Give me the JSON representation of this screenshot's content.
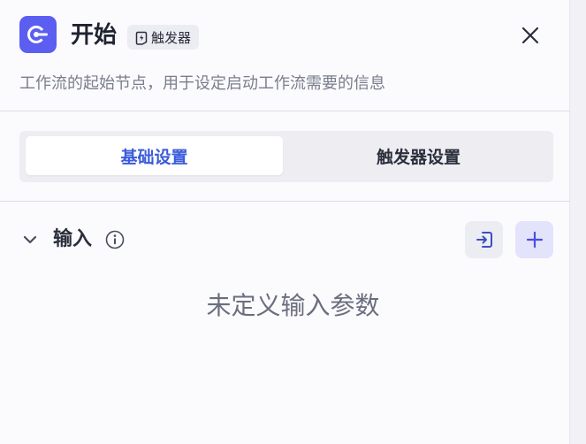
{
  "header": {
    "title": "开始",
    "badge_label": "触发器",
    "description": "工作流的起始节点，用于设定启动工作流需要的信息"
  },
  "tabs": [
    {
      "label": "基础设置",
      "active": true
    },
    {
      "label": "触发器设置",
      "active": false
    }
  ],
  "input_section": {
    "title": "输入",
    "empty_message": "未定义输入参数"
  },
  "icons": {
    "node": "start-node-icon",
    "badge": "lightning-icon",
    "close": "close-icon",
    "collapse": "chevron-down-icon",
    "info": "info-icon",
    "import": "import-icon",
    "add": "plus-icon"
  },
  "colors": {
    "accent": "#5b5ef0",
    "active_tab_text": "#3b5bdb",
    "add_button_bg": "#e3e3fb"
  }
}
